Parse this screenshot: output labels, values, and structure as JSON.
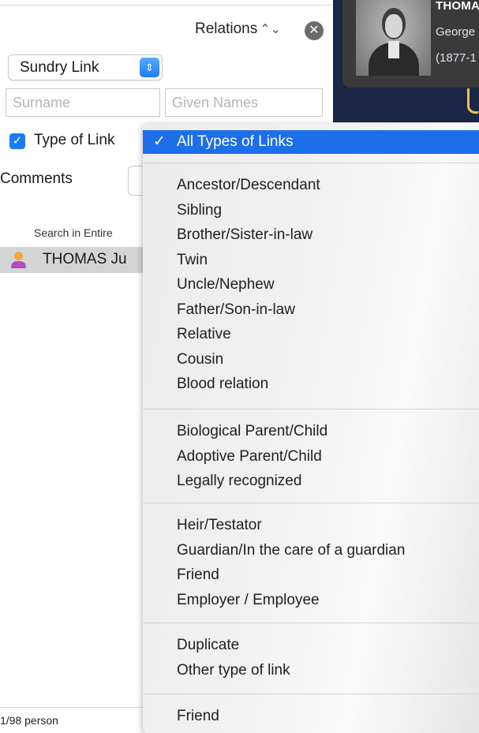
{
  "panel": {
    "title": "Relations",
    "title_icon": "up-down-chevron-icon",
    "close_icon": "close-icon",
    "link_select": {
      "value": "Sundry Link",
      "icon": "stepper-icon"
    },
    "surname": {
      "placeholder": "Surname",
      "value": ""
    },
    "given_names": {
      "placeholder": "Given Names",
      "value": ""
    },
    "type_of_link": {
      "label": "Type of Link",
      "checked": true
    },
    "comments": {
      "label": "Comments"
    },
    "search_entire": "Search in Entire",
    "results": [
      {
        "name": "THOMAS Ju",
        "icon": "person-icon"
      }
    ],
    "footer_count": "1/98 person"
  },
  "card": {
    "name_line": "THOMA",
    "given_line": "George",
    "dates_line": "(1877-1"
  },
  "dropdown": {
    "selected": {
      "check": "✓",
      "label": "All Types of Links"
    },
    "groups": [
      [
        "Ancestor/Descendant",
        "Sibling",
        "Brother/Sister-in-law",
        "Twin",
        "Uncle/Nephew",
        "Father/Son-in-law",
        "Relative",
        "Cousin",
        "Blood relation"
      ],
      [
        "Biological Parent/Child",
        "Adoptive Parent/Child",
        "Legally recognized"
      ],
      [
        "Heir/Testator",
        "Guardian/In the care of a guardian",
        "Friend",
        "Employer / Employee"
      ],
      [
        "Duplicate",
        "Other type of link"
      ],
      [
        "Friend"
      ]
    ]
  },
  "colors": {
    "accent": "#1d6fe9",
    "card_bg": "#1c2647",
    "connector": "#f0c445"
  }
}
